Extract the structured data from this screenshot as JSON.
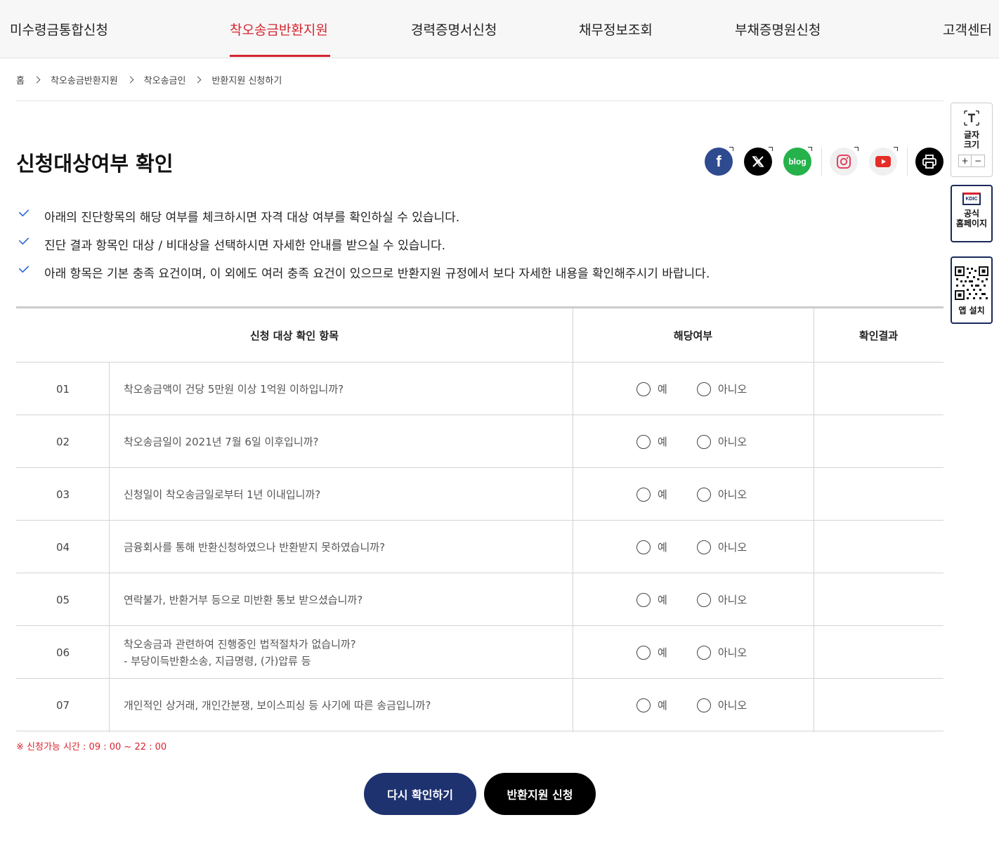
{
  "nav": {
    "items": [
      "미수령금통합신청",
      "착오송금반환지원",
      "경력증명서신청",
      "채무정보조회",
      "부채증명원신청",
      "고객센터"
    ],
    "active": "착오송금반환지원"
  },
  "breadcrumb": [
    "홈",
    "착오송금반환지원",
    "착오송금인",
    "반환지원 신청하기"
  ],
  "page_title": "신청대상여부 확인",
  "share": {
    "icons": [
      "facebook-icon",
      "x-twitter-icon",
      "blog-icon",
      "instagram-icon",
      "youtube-icon",
      "print-icon"
    ],
    "facebook": "f",
    "blog": "blog"
  },
  "notes": [
    "아래의 진단항목의 해당 여부를 체크하시면 자격 대상 여부를 확인하실 수 있습니다.",
    "진단 결과 항목인 대상 / 비대상을 선택하시면 자세한 안내를 받으실 수 있습니다.",
    "아래 항목은 기본 충족 요건이며, 이 외에도 여러 충족 요건이 있으므로 반환지원 규정에서 보다 자세한 내용을 확인해주시기 바랍니다."
  ],
  "table": {
    "headers": [
      "신청 대상 확인 항목",
      "해당여부",
      "확인결과"
    ],
    "yes_label": "예",
    "no_label": "아니오",
    "rows": [
      {
        "num": "01",
        "q": "착오송금액이 건당 5만원 이상 1억원 이하입니까?",
        "sub": ""
      },
      {
        "num": "02",
        "q": "착오송금일이 2021년 7월 6일 이후입니까?",
        "sub": ""
      },
      {
        "num": "03",
        "q": "신청일이 착오송금일로부터 1년 이내입니까?",
        "sub": ""
      },
      {
        "num": "04",
        "q": "금융회사를 통해 반환신청하였으나 반환받지 못하였습니까?",
        "sub": ""
      },
      {
        "num": "05",
        "q": "연락불가, 반환거부 등으로 미반환 통보 받으셨습니까?",
        "sub": ""
      },
      {
        "num": "06",
        "q": "착오송금과 관련하여 진행중인 법적절차가 없습니까?",
        "sub": "- 부당이득반환소송, 지급명령, (가)압류 등"
      },
      {
        "num": "07",
        "q": "개인적인 상거래, 개인간분쟁, 보이스피싱 등 사기에 따른 송금입니까?",
        "sub": ""
      }
    ]
  },
  "notice": "※ 신청가능 시간 : 09 : 00 ~ 22 : 00",
  "buttons": {
    "recheck": "다시 확인하기",
    "apply": "반환지원 신청"
  },
  "side": {
    "fontsize_label": "글자\n크기",
    "plus": "+",
    "minus": "−",
    "kdic_logo": "KDIC",
    "kdic_label": "공식\n홈페이지",
    "app_label": "앱 설치"
  },
  "colors": {
    "accent_red": "#d6242f",
    "navy_button": "#1e3270",
    "black_button": "#000000",
    "facebook": "#2d4b8e",
    "blog": "#25b24a",
    "check_blue": "#2a6bd1"
  }
}
